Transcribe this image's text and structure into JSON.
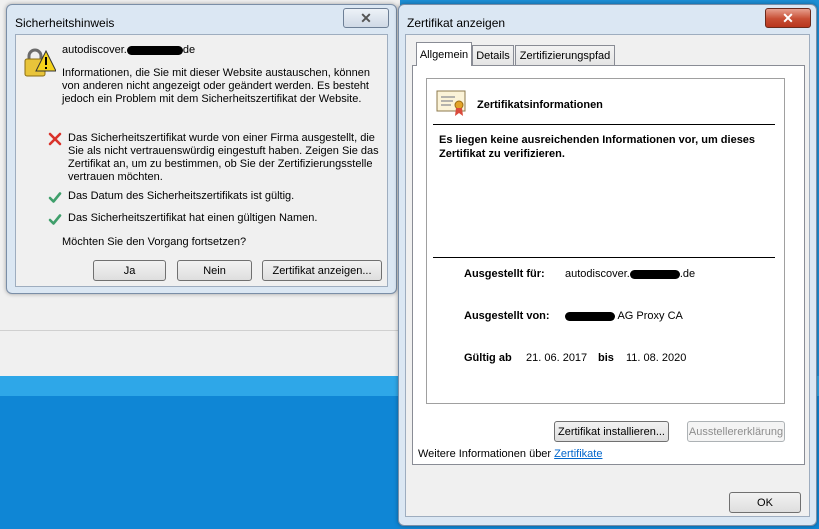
{
  "security_dialog": {
    "title": "Sicherheitshinweis",
    "host_prefix": "autodiscover.",
    "host_suffix": "de",
    "info": "Informationen, die Sie mit dieser Website austauschen, können von anderen nicht angezeigt oder geändert werden. Es besteht jedoch ein Problem mit dem Sicherheitszertifikat der Website.",
    "items": [
      {
        "status": "error",
        "icon": "red-x-icon",
        "text": "Das Sicherheitszertifikat wurde von einer Firma ausgestellt, die Sie als nicht vertrauenswürdig eingestuft haben. Zeigen Sie das Zertifikat an, um zu bestimmen, ob Sie der Zertifizierungsstelle vertrauen möchten."
      },
      {
        "status": "ok",
        "icon": "green-check-icon",
        "text": "Das Datum des Sicherheitszertifikats ist gültig."
      },
      {
        "status": "ok",
        "icon": "green-check-icon",
        "text": "Das Sicherheitszertifikat hat einen gültigen Namen."
      }
    ],
    "question": "Möchten Sie den Vorgang fortsetzen?",
    "buttons": {
      "yes": "Ja",
      "no": "Nein",
      "view": "Zertifikat anzeigen..."
    }
  },
  "cert_dialog": {
    "title": "Zertifikat anzeigen",
    "tabs": [
      "Allgemein",
      "Details",
      "Zertifizierungspfad"
    ],
    "active_tab": "Allgemein",
    "heading": "Zertifikatsinformationen",
    "message": "Es liegen keine ausreichenden Informationen vor, um dieses Zertifikat zu verifizieren.",
    "issued_to_label": "Ausgestellt für:",
    "issued_to_prefix": "autodiscover.",
    "issued_to_suffix": ".de",
    "issued_by_label": "Ausgestellt von:",
    "issued_by_suffix": " AG Proxy CA",
    "valid_from_label": "Gültig ab",
    "valid_from": "21. 06. 2017",
    "valid_to_label": "bis",
    "valid_to": "11. 08. 2020",
    "install_button": "Zertifikat installieren...",
    "issuer_statement_button": "Ausstellererklärung",
    "more_info_prefix": "Weitere Informationen über",
    "more_info_link": "Zertifikate",
    "ok_button": "OK"
  },
  "colors": {
    "error": "#d9322a",
    "ok": "#3f9f6b",
    "link": "#0066cc",
    "desktop": "#0f86d5"
  }
}
